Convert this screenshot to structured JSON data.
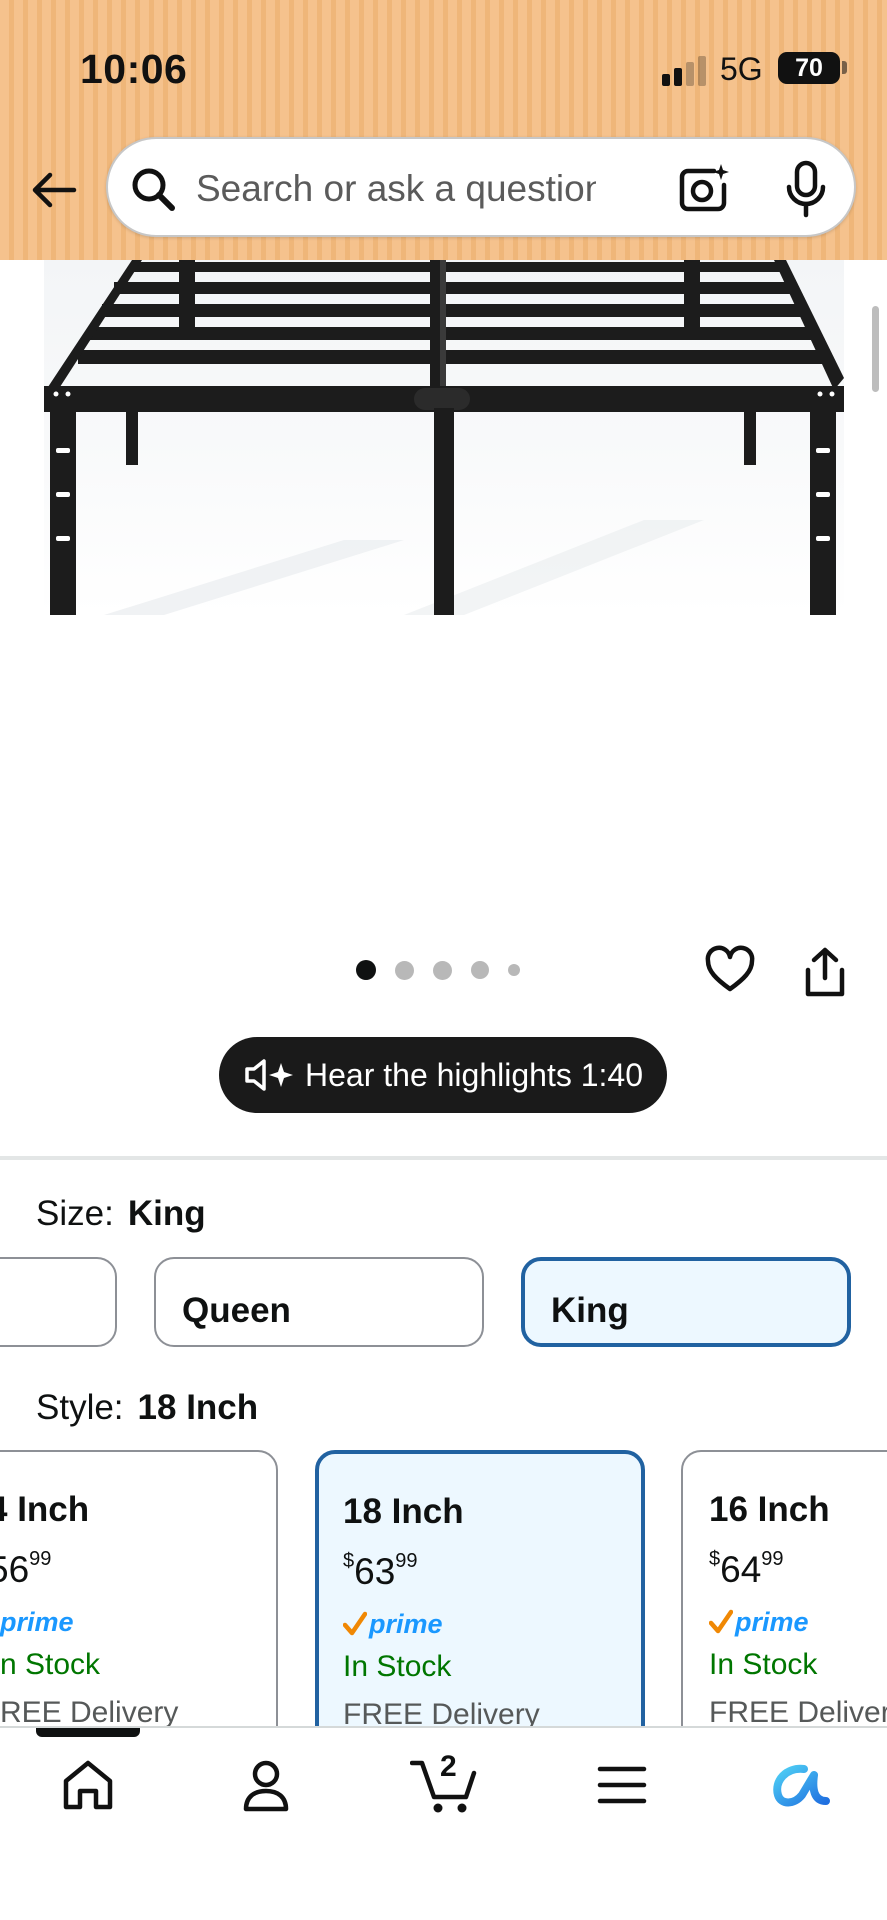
{
  "status_bar": {
    "time": "10:06",
    "network": "5G",
    "battery": "70",
    "battery_level": 0.7
  },
  "header": {
    "back_icon": "arrow-left-icon",
    "search": {
      "placeholder": "Search or ask a question",
      "value": ""
    },
    "icons": [
      "search-icon",
      "camera-lens-icon",
      "microphone-icon"
    ]
  },
  "gallery": {
    "image_alt": "black metal platform bed frame",
    "image_count": 5,
    "active_index": 0,
    "actions": [
      "heart-icon",
      "share-icon"
    ]
  },
  "audio": {
    "label": "Hear the highlights 1:40",
    "icon": "speaker-sparkle-icon"
  },
  "size": {
    "label": "Size:",
    "selected": "King",
    "options": [
      {
        "label": "",
        "selected": false
      },
      {
        "label": "Queen",
        "selected": false
      },
      {
        "label": "King",
        "selected": true
      }
    ]
  },
  "style": {
    "label": "Style:",
    "selected": "18 Inch",
    "options": [
      {
        "title": "4 Inch",
        "price_symbol": "",
        "price_whole": "56",
        "price_fraction": "99",
        "prime": "prime",
        "stock": "n Stock",
        "delivery": "REE Delivery",
        "selected": false
      },
      {
        "title": "18 Inch",
        "price_symbol": "$",
        "price_whole": "63",
        "price_fraction": "99",
        "prime": "prime",
        "stock": "In Stock",
        "delivery": "FREE Delivery",
        "selected": true
      },
      {
        "title": "16 Inch",
        "price_symbol": "$",
        "price_whole": "64",
        "price_fraction": "99",
        "prime": "prime",
        "stock": "In Stock",
        "delivery": "FREE Delivery",
        "selected": false
      }
    ]
  },
  "bottom_nav": {
    "items": [
      "home-icon",
      "account-icon",
      "cart-icon",
      "menu-icon",
      "rufus-ai-icon"
    ],
    "cart_count": "2",
    "active_index": 0
  },
  "colors": {
    "header_bg": "#f5c28d",
    "selected_border": "#2162a1",
    "selected_bg": "#edf8ff",
    "in_stock": "#007600",
    "prime_blue": "#1a98ff",
    "prime_check": "#f08804"
  }
}
